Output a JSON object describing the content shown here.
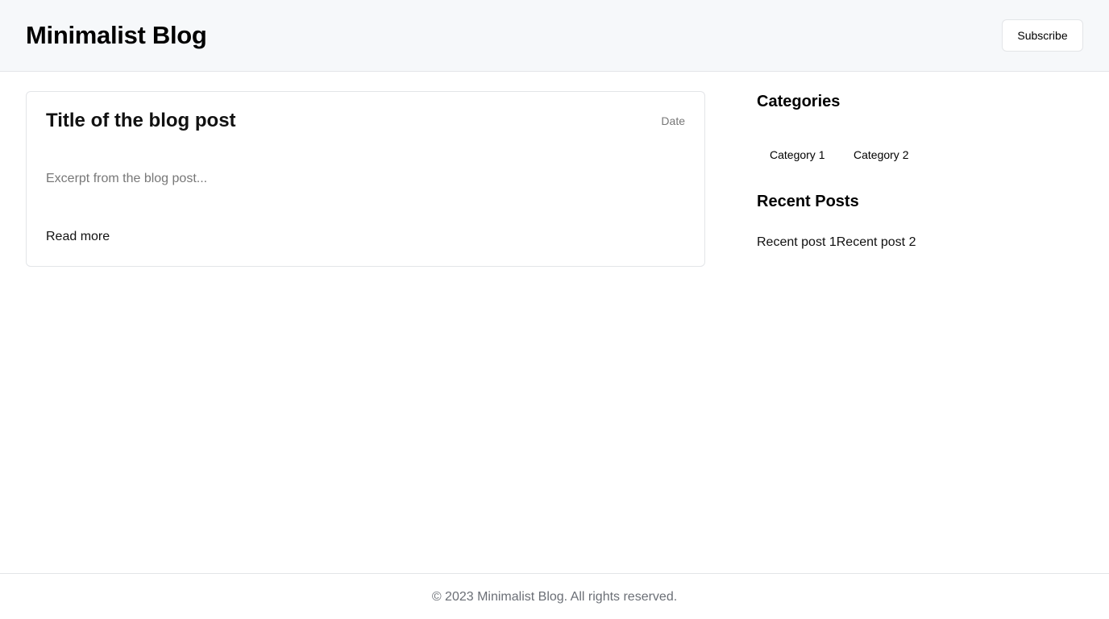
{
  "header": {
    "title": "Minimalist Blog",
    "subscribe_label": "Subscribe"
  },
  "post": {
    "title": "Title of the blog post",
    "date": "Date",
    "excerpt": "Excerpt from the blog post...",
    "read_more": "Read more"
  },
  "sidebar": {
    "categories_heading": "Categories",
    "categories": [
      "Category 1",
      "Category 2"
    ],
    "recent_heading": "Recent Posts",
    "recent_posts": [
      "Recent post 1",
      "Recent post 2"
    ]
  },
  "footer": {
    "text": "© 2023 Minimalist Blog. All rights reserved."
  }
}
